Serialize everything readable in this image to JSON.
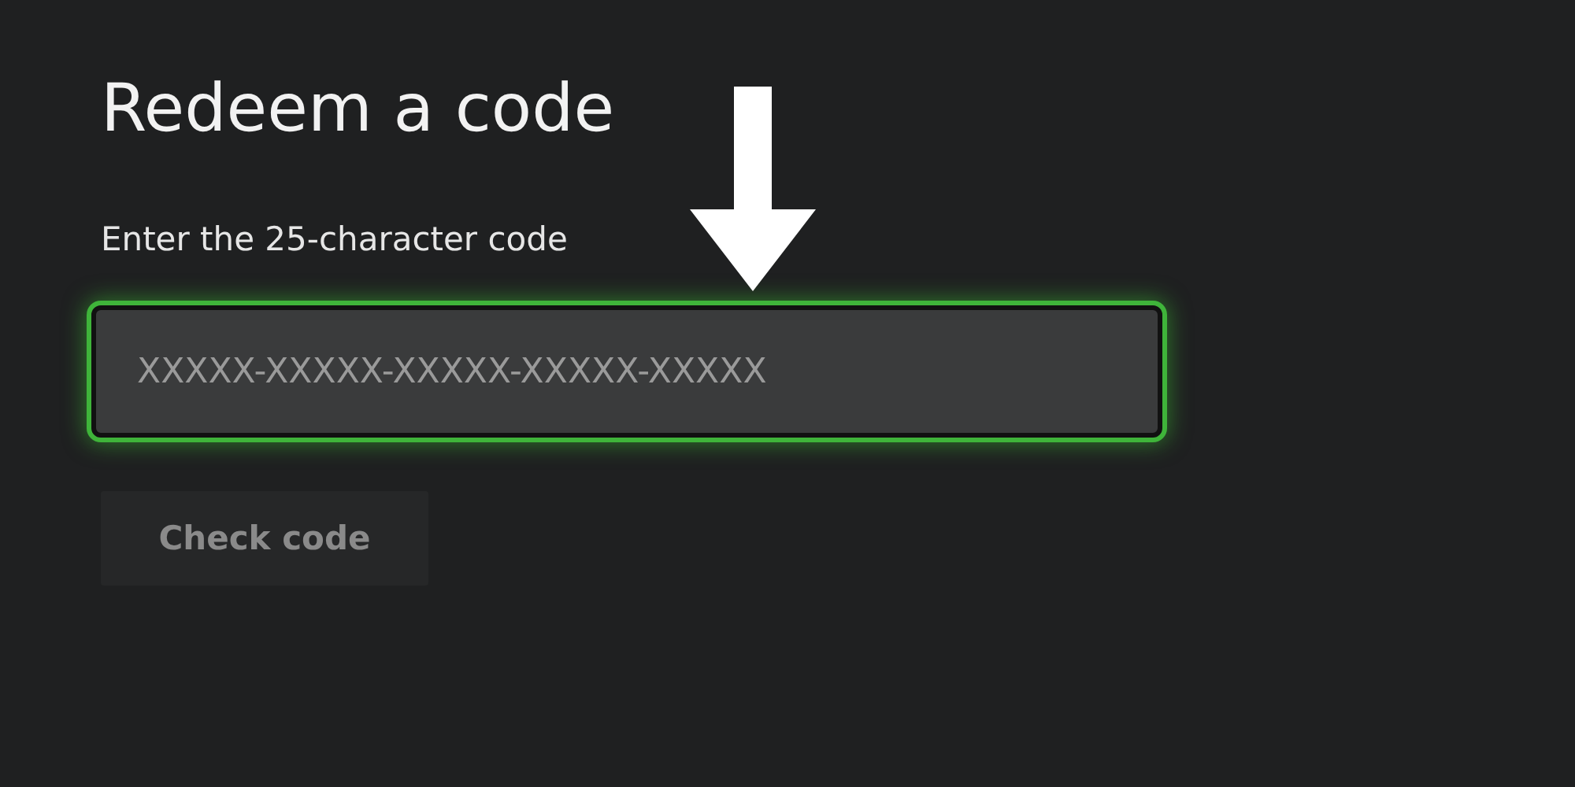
{
  "title": "Redeem a code",
  "code_field": {
    "label": "Enter the 25-character code",
    "placeholder": "XXXXX-XXXXX-XXXXX-XXXXX-XXXXX",
    "focused": true
  },
  "check_button": {
    "label": "Check code",
    "disabled": true
  }
}
